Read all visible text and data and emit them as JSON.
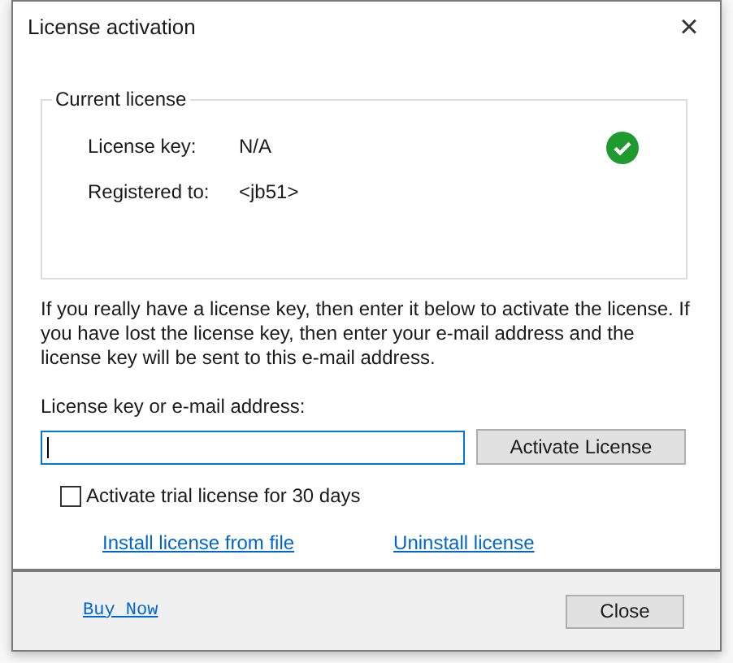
{
  "window": {
    "title": "License activation",
    "close": "×"
  },
  "current_license": {
    "legend": "Current license",
    "valid": true,
    "fields": [
      {
        "label": "License key:",
        "value": "N/A"
      },
      {
        "label": "Registered to:",
        "value": "<jb51>"
      }
    ]
  },
  "description": "If you really have a license key, then enter it below to activate the license. If you have lost the license key, then enter your e-mail address and the license key will be sent to this e-mail address.",
  "input": {
    "label": "License key or e-mail address:",
    "focused": true
  },
  "activate_button": "Activate License",
  "trial": {
    "label": "Activate trial license for 30 days",
    "checked": false
  },
  "links": [
    "Install license from file",
    "Uninstall license"
  ],
  "footer": {
    "link": "Buy Now",
    "button": "Close"
  }
}
